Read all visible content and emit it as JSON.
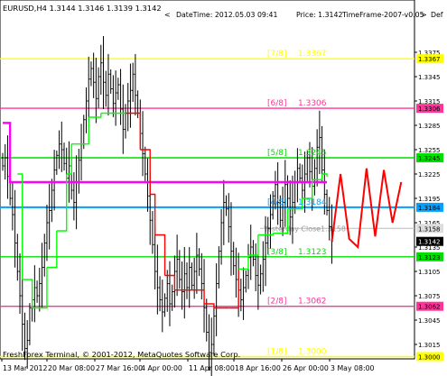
{
  "header": {
    "symbol_text": "EURUSD,H4  1.3144 1.3146 1.3139 1.3142",
    "datetime_text": "DateTime: 2012.05.03 09:41",
    "price_text": "Price: 1.3142",
    "timeframe_text": "TimeFrame-2007-v0.05",
    "scroll_left_label": "<",
    "scroll_right_label": ">",
    "cut_text": "Def"
  },
  "colors": {
    "background": "#ffffff",
    "candles": "#000000",
    "yellow_level": "#ffff00",
    "pink_level": "#ff3399",
    "green_level": "#00dd00",
    "blue_level": "#00a0ff",
    "magenta_line": "#ff00ff",
    "red_line": "#ff0000",
    "green_line": "#00ff00",
    "forecast_line": "#ff0000"
  },
  "chart_data": {
    "type": "candlestick",
    "symbol": "EURUSD",
    "timeframe": "H4",
    "ylim": [
      1.2992,
      1.3405
    ],
    "y_ticks": [
      "1.3375",
      "1.3345",
      "1.3315",
      "1.3285",
      "1.3255",
      "1.3225",
      "1.3195",
      "1.3165",
      "1.3135",
      "1.3105",
      "1.3075",
      "1.3045",
      "1.3015"
    ],
    "x_ticks": [
      "13 Mar 2012",
      "20 Mar 08:00",
      "27 Mar 16:00",
      "4 Apr 00:00",
      "11 Apr 08:00",
      "18 Apr 16:00",
      "26 Apr 00:00",
      "3 May 08:00"
    ],
    "murrey_levels": [
      {
        "label": "[7/8]",
        "value": 1.3367,
        "value_text": "1.3367",
        "tag": "1.3367",
        "color": "yellow"
      },
      {
        "label": "[6/8]",
        "value": 1.3306,
        "value_text": "1.3306",
        "tag": "1.3306",
        "color": "pink"
      },
      {
        "label": "[5/8]",
        "value": 1.3245,
        "value_text": "1.3245",
        "tag": "1.3245",
        "color": "green"
      },
      {
        "label": "[4/8]",
        "value": 1.3184,
        "value_text": "1.3184",
        "tag": "1.3184",
        "color": "blue"
      },
      {
        "label": "[3/8]",
        "value": 1.3123,
        "value_text": "1.3123",
        "tag": "1.3123",
        "color": "green"
      },
      {
        "label": "[2/8]",
        "value": 1.3062,
        "value_text": "1.3062",
        "tag": "1.3062",
        "color": "pink"
      },
      {
        "label": "[1/8]",
        "value": 1.3,
        "value_text": "1.3000",
        "tag": "1.3000",
        "color": "yellow"
      }
    ],
    "current_price": {
      "value": 1.3142,
      "tag": "1.3142"
    },
    "yesterday_close": {
      "label": "Yesterday Close",
      "value": 1.3158,
      "value_text": "1.3158",
      "tag": "1.3158"
    },
    "closes": [
      1.3235,
      1.3245,
      1.3222,
      1.3195,
      1.3175,
      1.314,
      1.3105,
      1.3075,
      1.304,
      1.301,
      1.302,
      1.306,
      1.307,
      1.3085,
      1.3075,
      1.309,
      1.311,
      1.314,
      1.3165,
      1.318,
      1.3205,
      1.323,
      1.3248,
      1.3262,
      1.3255,
      1.3238,
      1.322,
      1.3235,
      1.3205,
      1.319,
      1.3215,
      1.3242,
      1.3262,
      1.3292,
      1.3315,
      1.3342,
      1.3355,
      1.3338,
      1.3318,
      1.3345,
      1.3362,
      1.3338,
      1.3322,
      1.3348,
      1.333,
      1.3312,
      1.3325,
      1.3335,
      1.3305,
      1.328,
      1.33,
      1.3315,
      1.3328,
      1.3348,
      1.3322,
      1.33,
      1.3275,
      1.325,
      1.3225,
      1.3198,
      1.3168,
      1.3138,
      1.3105,
      1.3085,
      1.307,
      1.3055,
      1.3072,
      1.309,
      1.3065,
      1.308,
      1.3105,
      1.312,
      1.3095,
      1.308,
      1.3102,
      1.3085,
      1.311,
      1.3088,
      1.3105,
      1.3125,
      1.3108,
      1.309,
      1.306,
      1.303,
      1.3005,
      1.3015,
      1.305,
      1.309,
      1.313,
      1.3165,
      1.319,
      1.3182,
      1.316,
      1.313,
      1.3112,
      1.3095,
      1.3082,
      1.307,
      1.3085,
      1.31,
      1.3122,
      1.3135,
      1.312,
      1.31,
      1.3088,
      1.3102,
      1.312,
      1.314,
      1.3158,
      1.3175,
      1.3198,
      1.3212,
      1.319,
      1.3168,
      1.319,
      1.3212,
      1.3195,
      1.3172,
      1.319,
      1.3215,
      1.3232,
      1.322,
      1.3205,
      1.3225,
      1.3245,
      1.3228,
      1.321,
      1.3232,
      1.3258,
      1.327,
      1.323,
      1.32,
      1.318,
      1.316,
      1.3142
    ],
    "forecast": [
      1.3225,
      1.3145,
      1.3135,
      1.3232,
      1.3148,
      1.323,
      1.3165,
      1.3215
    ],
    "magenta_line": [
      [
        0,
        1.3288
      ],
      [
        3,
        1.3288
      ],
      [
        3,
        1.3215
      ],
      [
        42,
        1.3215
      ],
      [
        132,
        1.3215
      ]
    ],
    "green_steps": [
      [
        6,
        1.3225
      ],
      [
        8,
        1.3095
      ],
      [
        12,
        1.306
      ],
      [
        18,
        1.311
      ],
      [
        22,
        1.3155
      ],
      [
        26,
        1.3225
      ],
      [
        28,
        1.3262
      ],
      [
        35,
        1.3295
      ],
      [
        40,
        1.33
      ],
      [
        43,
        1.33
      ],
      [
        50,
        1.33
      ],
      [
        56,
        1.3255
      ],
      [
        60,
        1.32
      ],
      [
        62,
        1.315
      ],
      [
        66,
        1.31
      ],
      [
        70,
        1.3082
      ],
      [
        76,
        1.3082
      ],
      [
        82,
        1.3065
      ],
      [
        86,
        1.306
      ],
      [
        92,
        1.306
      ],
      [
        96,
        1.3108
      ],
      [
        100,
        1.3125
      ],
      [
        104,
        1.315
      ],
      [
        110,
        1.3152
      ],
      [
        116,
        1.3182
      ],
      [
        122,
        1.3195
      ],
      [
        126,
        1.3218
      ],
      [
        130,
        1.3225
      ],
      [
        132,
        1.3222
      ]
    ],
    "red_span": [
      52,
      96
    ]
  },
  "watermark": "FreshForex Terminal, © 2001-2012, MetaQuotes Software Corp."
}
